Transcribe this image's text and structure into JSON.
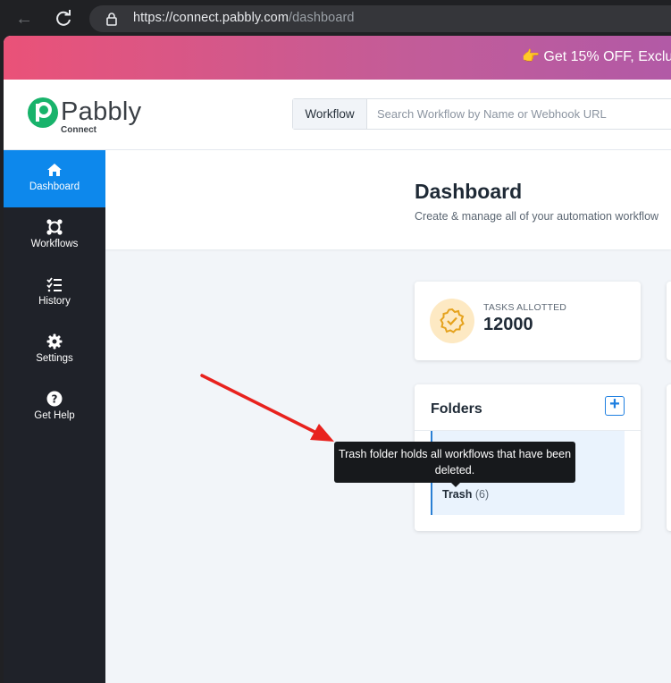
{
  "browser": {
    "url_host": "https://connect.pabbly.com",
    "url_path": "/dashboard",
    "back_icon": "arrow-left-icon",
    "reload_icon": "reload-icon",
    "lock_icon": "lock-icon"
  },
  "promo": {
    "emoji": "👉",
    "text": "Get 15% OFF, Exclu"
  },
  "header": {
    "logo_name": "Pabbly",
    "logo_sub": "Connect",
    "search_select": "Workflow",
    "search_placeholder": "Search Workflow by Name or Webhook URL",
    "search_value": ""
  },
  "sidebar": {
    "items": [
      {
        "label": "Dashboard",
        "icon": "home-icon",
        "active": true
      },
      {
        "label": "Workflows",
        "icon": "workflows-icon",
        "active": false
      },
      {
        "label": "History",
        "icon": "history-icon",
        "active": false
      },
      {
        "label": "Settings",
        "icon": "gear-icon",
        "active": false
      },
      {
        "label": "Get Help",
        "icon": "help-icon",
        "active": false
      }
    ]
  },
  "main": {
    "title": "Dashboard",
    "subtitle": "Create & manage all of your automation workflow"
  },
  "tasks_card": {
    "label": "TASKS ALLOTTED",
    "value": "12000",
    "icon": "verified-badge-icon"
  },
  "folders_card": {
    "title": "Folders",
    "add_icon": "plus-icon",
    "folder_name": "Trash",
    "folder_count": "(6)"
  },
  "tooltip": {
    "text": "Trash folder holds all workflows that have been deleted."
  },
  "colors": {
    "sidebar_bg": "#1f2229",
    "sidebar_active": "#0d88ec",
    "accent_blue": "#1e7fe0",
    "annotation_red": "#e8221e",
    "promo_start": "#ea5278",
    "promo_end": "#b25aa6"
  }
}
